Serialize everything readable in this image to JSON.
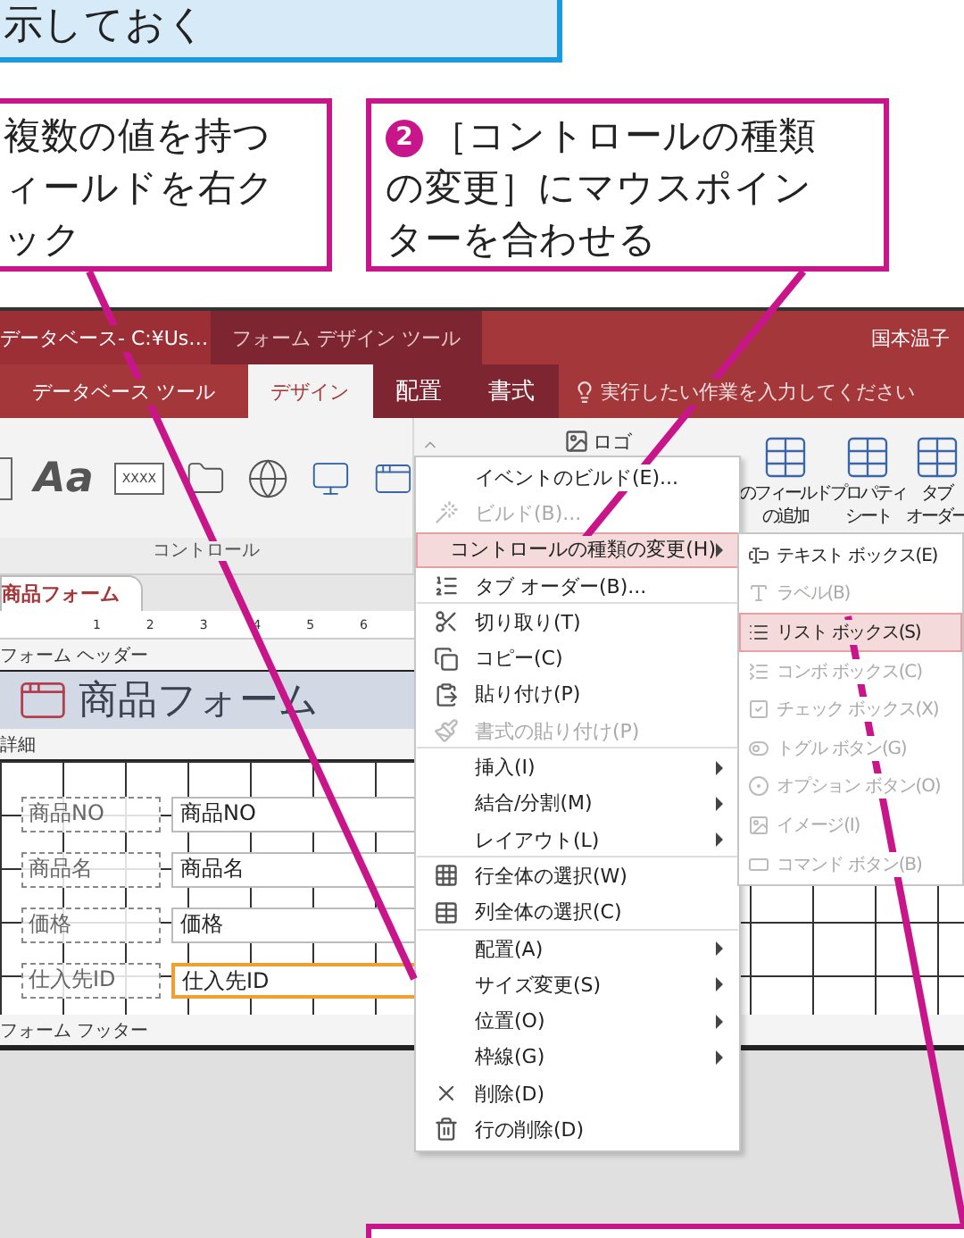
{
  "top_callout": {
    "text": "示しておく"
  },
  "callouts": [
    {
      "lines": [
        "複数の値を持つ",
        "ィールドを右ク",
        "ック"
      ]
    },
    {
      "number": "2",
      "lines": [
        "［コントロールの種類",
        "の変更］にマウスポイン",
        "ターを合わせる"
      ]
    }
  ],
  "window": {
    "title": "データベース- C:¥Us…",
    "tool_context": "フォーム デザイン ツール",
    "user": "国本温子",
    "tell_me": "実行したい作業を入力してください"
  },
  "tabs": [
    {
      "label": "データベース ツール",
      "selected": false
    },
    {
      "label": "デザイン",
      "selected": true
    },
    {
      "label": "配置",
      "selected": false
    },
    {
      "label": "書式",
      "selected": false
    }
  ],
  "ribbon": {
    "label_control": "Aa",
    "text_control": "XXXX",
    "group_label": "コントロール",
    "logo_button": "ロゴ",
    "buttons": [
      {
        "lines": [
          "のフィールド",
          "の追加"
        ]
      },
      {
        "lines": [
          "プロパティ",
          "シート"
        ]
      },
      {
        "lines": [
          "タブ",
          "オーダー"
        ]
      }
    ]
  },
  "document_tab": "商品フォーム",
  "ruler": [
    "1",
    "2",
    "3",
    "4",
    "5",
    "6"
  ],
  "form": {
    "header_bar": "フォーム ヘッダー",
    "title": "商品フォーム",
    "detail_bar": "詳細",
    "footer_bar": "フォーム フッター",
    "fields": [
      {
        "label": "商品NO",
        "value": "商品NO",
        "selected": false
      },
      {
        "label": "商品名",
        "value": "商品名",
        "selected": false
      },
      {
        "label": "価格",
        "value": "価格",
        "selected": false
      },
      {
        "label": "仕入先ID",
        "value": "仕入先ID",
        "selected": true
      }
    ]
  },
  "context_menu": [
    {
      "label": "イベントのビルド(E)...",
      "disabled": false,
      "selected": false,
      "submenu": false,
      "divider_after": false
    },
    {
      "label": "ビルド(B)...",
      "disabled": true,
      "selected": false,
      "submenu": false,
      "divider_after": false
    },
    {
      "label": "コントロールの種類の変更(H)",
      "disabled": false,
      "selected": true,
      "submenu": true,
      "divider_after": false
    },
    {
      "label": "タブ オーダー(B)...",
      "disabled": false,
      "selected": false,
      "submenu": false,
      "divider_after": true
    },
    {
      "label": "切り取り(T)",
      "disabled": false,
      "selected": false,
      "submenu": false,
      "divider_after": false
    },
    {
      "label": "コピー(C)",
      "disabled": false,
      "selected": false,
      "submenu": false,
      "divider_after": false
    },
    {
      "label": "貼り付け(P)",
      "disabled": false,
      "selected": false,
      "submenu": false,
      "divider_after": false
    },
    {
      "label": "書式の貼り付け(P)",
      "disabled": true,
      "selected": false,
      "submenu": false,
      "divider_after": true
    },
    {
      "label": "挿入(I)",
      "disabled": false,
      "selected": false,
      "submenu": true,
      "divider_after": false
    },
    {
      "label": "結合/分割(M)",
      "disabled": false,
      "selected": false,
      "submenu": true,
      "divider_after": false
    },
    {
      "label": "レイアウト(L)",
      "disabled": false,
      "selected": false,
      "submenu": true,
      "divider_after": true
    },
    {
      "label": "行全体の選択(W)",
      "disabled": false,
      "selected": false,
      "submenu": false,
      "divider_after": false
    },
    {
      "label": "列全体の選択(C)",
      "disabled": false,
      "selected": false,
      "submenu": false,
      "divider_after": true
    },
    {
      "label": "配置(A)",
      "disabled": false,
      "selected": false,
      "submenu": true,
      "divider_after": false
    },
    {
      "label": "サイズ変更(S)",
      "disabled": false,
      "selected": false,
      "submenu": true,
      "divider_after": false
    },
    {
      "label": "位置(O)",
      "disabled": false,
      "selected": false,
      "submenu": true,
      "divider_after": false
    },
    {
      "label": "枠線(G)",
      "disabled": false,
      "selected": false,
      "submenu": true,
      "divider_after": false
    },
    {
      "label": "削除(D)",
      "disabled": false,
      "selected": false,
      "submenu": false,
      "divider_after": false
    },
    {
      "label": "行の削除(D)",
      "disabled": false,
      "selected": false,
      "submenu": false,
      "divider_after": false
    }
  ],
  "submenu": [
    {
      "label": "テキスト ボックス(E)",
      "disabled": false,
      "selected": false
    },
    {
      "label": "ラベル(B)",
      "disabled": true,
      "selected": false
    },
    {
      "label": "リスト ボックス(S)",
      "disabled": false,
      "selected": true
    },
    {
      "label": "コンボ ボックス(C)",
      "disabled": true,
      "selected": false
    },
    {
      "label": "チェック ボックス(X)",
      "disabled": true,
      "selected": false
    },
    {
      "label": "トグル ボタン(G)",
      "disabled": true,
      "selected": false
    },
    {
      "label": "オプション ボタン(O)",
      "disabled": true,
      "selected": false
    },
    {
      "label": "イメージ(I)",
      "disabled": true,
      "selected": false
    },
    {
      "label": "コマンド ボタン(B)",
      "disabled": true,
      "selected": false
    }
  ]
}
